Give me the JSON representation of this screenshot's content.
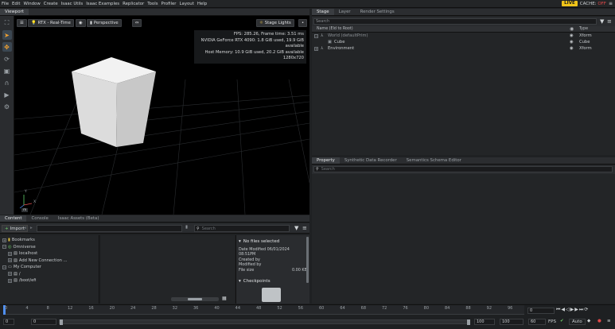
{
  "menu": [
    "File",
    "Edit",
    "Window",
    "Create",
    "Isaac Utils",
    "Isaac Examples",
    "Replicator",
    "Tools",
    "Profiler",
    "Layout",
    "Help"
  ],
  "status": {
    "live": "LIVE",
    "cache_label": "CACHE:",
    "cache_state": "OFF"
  },
  "viewport": {
    "tab": "Viewport",
    "render_mode": "RTX - Real-Time",
    "camera": "Perspective",
    "stage_lights": "Stage Lights",
    "hud": {
      "fps_line": "FPS: 285.26, Frame time: 3.51 ms",
      "gpu_line": "NVIDIA GeForce RTX 4090: 1.8 GiB used, 19.9 GiB available",
      "host_line": "Host Memory: 10.9 GiB used, 20.2 GiB available",
      "resolution": "1280x720"
    },
    "axis_y": "Y",
    "axis_x": "X",
    "units": "m"
  },
  "content": {
    "tabs": [
      "Content",
      "Console",
      "Isaac Assets (Beta)"
    ],
    "import_label": "Import",
    "search_placeholder": "Search",
    "tree": [
      {
        "label": "Bookmarks",
        "indent": 0,
        "expander": "+"
      },
      {
        "label": "Omniverse",
        "indent": 0,
        "expander": "−"
      },
      {
        "label": "localhost",
        "indent": 1,
        "expander": "+"
      },
      {
        "label": "Add New Connection ...",
        "indent": 1,
        "expander": "+"
      },
      {
        "label": "My Computer",
        "indent": 0,
        "expander": "−"
      },
      {
        "label": "/",
        "indent": 1,
        "expander": "+"
      },
      {
        "label": "/boot/efi",
        "indent": 1,
        "expander": "+"
      }
    ],
    "details": {
      "title": "No files selected",
      "date_modified": "Date Modified 06/01/2024 08:51PM",
      "created_by": "Created by",
      "modified_by": "Modified by",
      "file_size_label": "File size",
      "file_size_value": "0.00 KB",
      "checkpoints": "Checkpoints"
    }
  },
  "stage": {
    "tabs": [
      "Stage",
      "Layer",
      "Render Settings"
    ],
    "search_placeholder": "Search",
    "columns": {
      "name": "Name (Eld to Root)",
      "type": "Type"
    },
    "rows": [
      {
        "name": "World (defaultPrim)",
        "type": "Xform",
        "indent": 0,
        "dim": true
      },
      {
        "name": "Cube",
        "type": "Cube",
        "indent": 1,
        "dim": false
      },
      {
        "name": "Environment",
        "type": "Xform",
        "indent": 0,
        "dim": false
      }
    ]
  },
  "property": {
    "tabs": [
      "Property",
      "Synthetic Data Recorder",
      "Semantics Schema Editor"
    ],
    "search_placeholder": "Search"
  },
  "timeline": {
    "ticks": [
      "0",
      "4",
      "8",
      "12",
      "16",
      "20",
      "24",
      "28",
      "32",
      "36",
      "40",
      "44",
      "48",
      "52",
      "56",
      "60",
      "64",
      "68",
      "72",
      "76",
      "80",
      "84",
      "88",
      "92",
      "96"
    ],
    "current_frame": "0",
    "start": "0",
    "end": "100",
    "end2": "100",
    "fps": "60",
    "fps_label": "FPS",
    "auto": "Auto"
  }
}
